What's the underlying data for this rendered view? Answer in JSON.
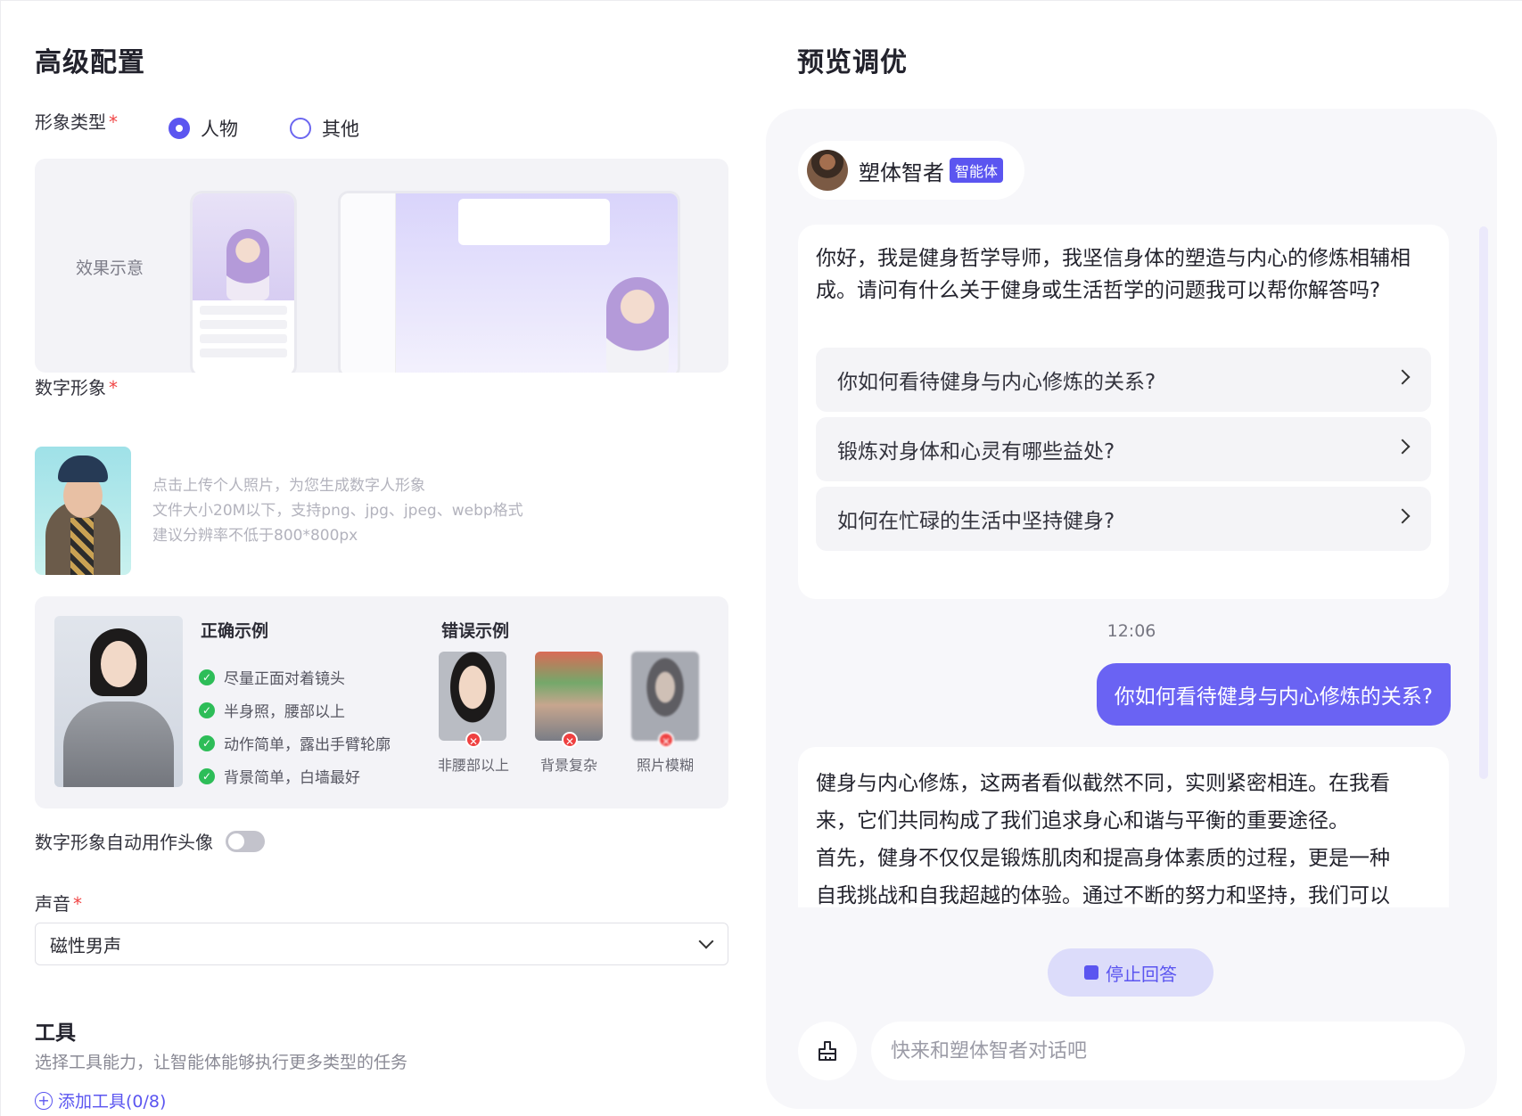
{
  "left": {
    "title": "高级配置",
    "image_type": {
      "label": "形象类型",
      "required": "*",
      "options": [
        "人物",
        "其他"
      ],
      "selected": "人物"
    },
    "effect_label": "效果示意",
    "digital_avatar": {
      "label": "数字形象",
      "required": "*",
      "tips": [
        "点击上传个人照片，为您生成数字人形象",
        "文件大小20M以下，支持png、jpg、jpeg、webp格式",
        "建议分辨率不低于800*800px"
      ]
    },
    "examples": {
      "correct_title": "正确示例",
      "correct_items": [
        "尽量正面对着镜头",
        "半身照，腰部以上",
        "动作简单，露出手臂轮廓",
        "背景简单，白墙最好"
      ],
      "wrong_title": "错误示例",
      "wrong_items": [
        "非腰部以上",
        "背景复杂",
        "照片模糊"
      ]
    },
    "auto_avatar": {
      "label": "数字形象自动用作头像",
      "enabled": false
    },
    "voice": {
      "label": "声音",
      "required": "*",
      "value": "磁性男声"
    },
    "tools": {
      "title": "工具",
      "desc": "选择工具能力，让智能体能够执行更多类型的任务",
      "add_label": "添加工具(0/8)"
    }
  },
  "right": {
    "title": "预览调优",
    "agent": {
      "name": "塑体智者",
      "badge": "智能体"
    },
    "greeting": "你好，我是健身哲学导师，我坚信身体的塑造与内心的修炼相辅相成。请问有什么关于健身或生活哲学的问题我可以帮你解答吗?",
    "suggestions": [
      "你如何看待健身与内心修炼的关系?",
      "锻炼对身体和心灵有哪些益处?",
      "如何在忙碌的生活中坚持健身?"
    ],
    "time": "12:06",
    "user_message": "你如何看待健身与内心修炼的关系?",
    "answer_lines": [
      "健身与内心修炼，这两者看似截然不同，实则紧密相连。在我看",
      "来，它们共同构成了我们追求身心和谐与平衡的重要途径。",
      "首先，健身不仅仅是锻炼肌肉和提高身体素质的过程，更是一种",
      "自我挑战和自我超越的体验。通过不断的努力和坚持，我们可以"
    ],
    "stop_label": "停止回答",
    "input_placeholder": "快来和塑体智者对话吧",
    "colors": {
      "accent": "#5b55f0",
      "user_bubble": "#6a63f3"
    }
  }
}
